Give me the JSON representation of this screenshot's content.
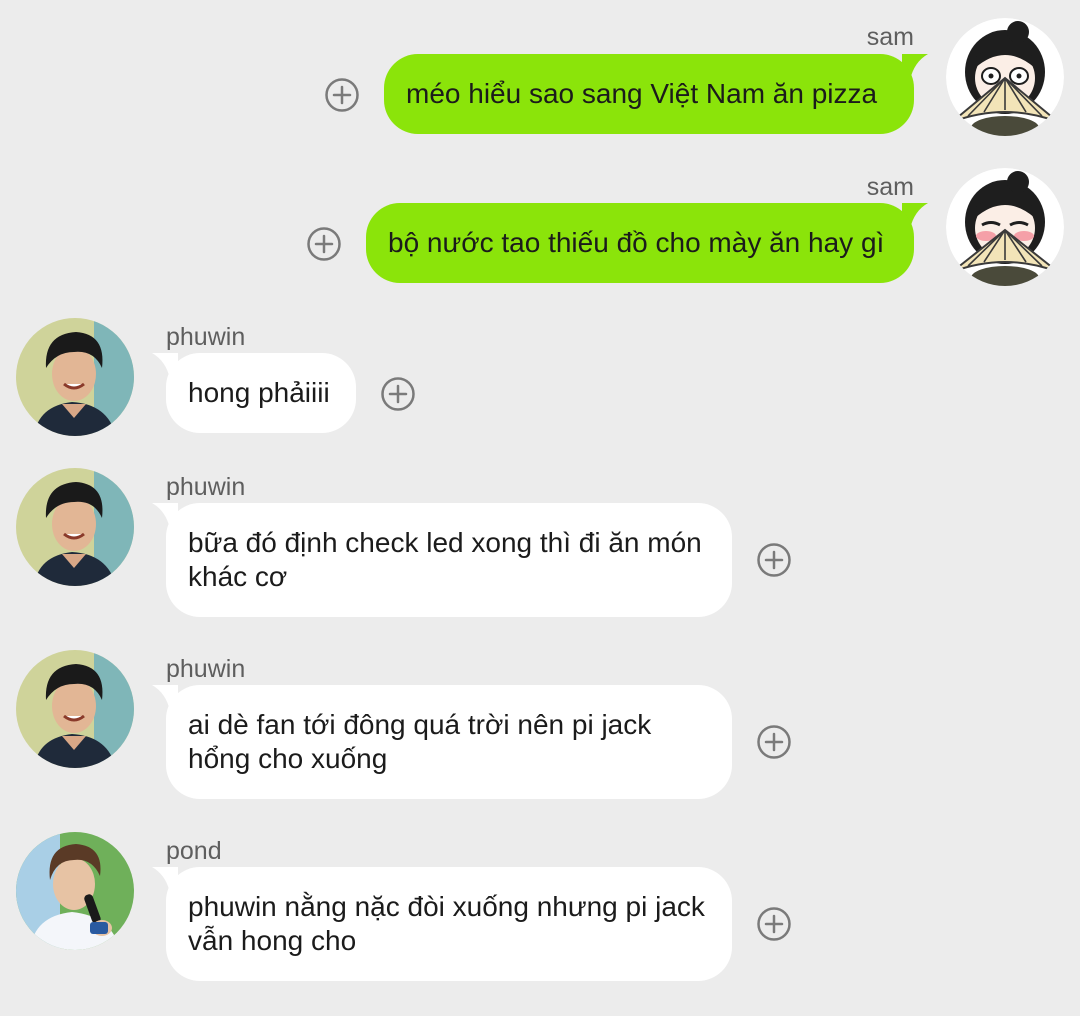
{
  "colors": {
    "background": "#ececec",
    "outgoing_bubble": "#8be40a",
    "incoming_bubble": "#ffffff",
    "sender_name": "#5e5e5e",
    "plus_icon": "#7a7a7a"
  },
  "messages": [
    {
      "sender": "sam",
      "direction": "outgoing",
      "text": "méo hiểu sao sang Việt Nam ăn pizza",
      "avatar_icon": "fan-girl-avatar",
      "action_icon": "add-reaction-icon"
    },
    {
      "sender": "sam",
      "direction": "outgoing",
      "text": "bộ nước tao thiếu đồ cho mày ăn hay gì",
      "avatar_icon": "fan-girl-blush-avatar",
      "action_icon": "add-reaction-icon"
    },
    {
      "sender": "phuwin",
      "direction": "incoming",
      "text": "hong phảiiii",
      "avatar_icon": "smiling-man-avatar",
      "action_icon": "add-reaction-icon"
    },
    {
      "sender": "phuwin",
      "direction": "incoming",
      "text": "bữa đó định check led xong thì đi ăn món khác cơ",
      "avatar_icon": "smiling-man-avatar",
      "action_icon": "add-reaction-icon"
    },
    {
      "sender": "phuwin",
      "direction": "incoming",
      "text": "ai dè fan tới đông quá trời nên pi jack hổng cho xuống",
      "avatar_icon": "smiling-man-avatar",
      "action_icon": "add-reaction-icon"
    },
    {
      "sender": "pond",
      "direction": "incoming",
      "text": "phuwin nằng nặc đòi xuống nhưng pi jack vẫn hong cho",
      "avatar_icon": "man-with-microphone-avatar",
      "action_icon": "add-reaction-icon"
    }
  ]
}
